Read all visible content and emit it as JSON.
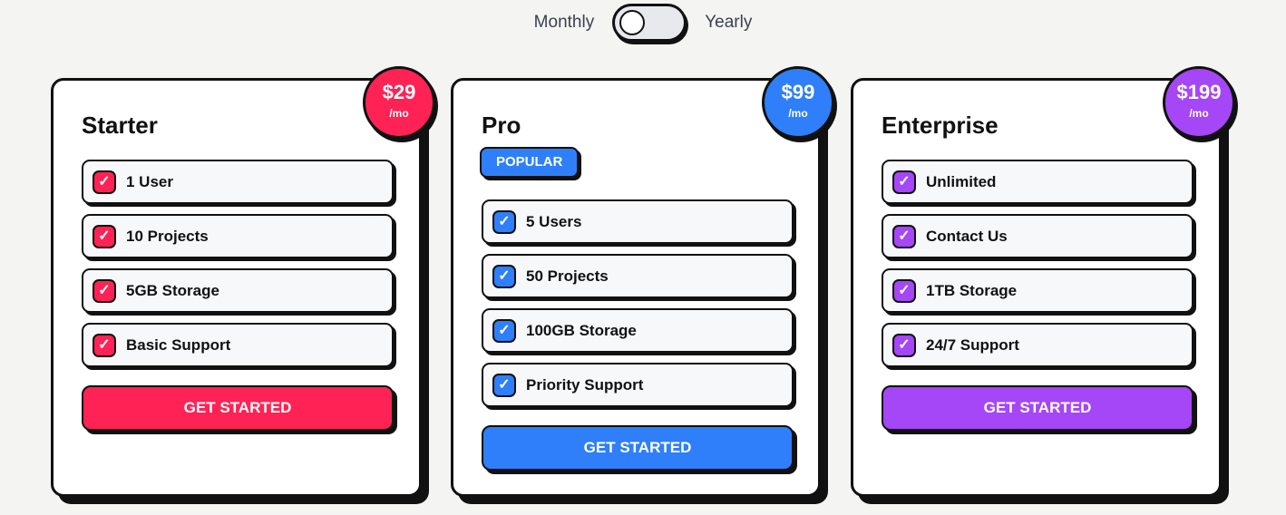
{
  "billing": {
    "monthly_label": "Monthly",
    "yearly_label": "Yearly",
    "selected": "Monthly"
  },
  "plans": [
    {
      "name": "Starter",
      "price": "$29",
      "period": "/mo",
      "color": "#ff2255",
      "features": [
        "1 User",
        "10 Projects",
        "5GB Storage",
        "Basic Support"
      ],
      "cta": "GET STARTED"
    },
    {
      "name": "Pro",
      "price": "$99",
      "period": "/mo",
      "color": "#2e7ff9",
      "badge": "POPULAR",
      "features": [
        "5 Users",
        "50 Projects",
        "100GB Storage",
        "Priority Support"
      ],
      "cta": "GET STARTED"
    },
    {
      "name": "Enterprise",
      "price": "$199",
      "period": "/mo",
      "color": "#a546f7",
      "features": [
        "Unlimited",
        "Contact Us",
        "1TB Storage",
        "24/7 Support"
      ],
      "cta": "GET STARTED"
    }
  ],
  "icons": {
    "feature_check": "checkmark-icon"
  }
}
